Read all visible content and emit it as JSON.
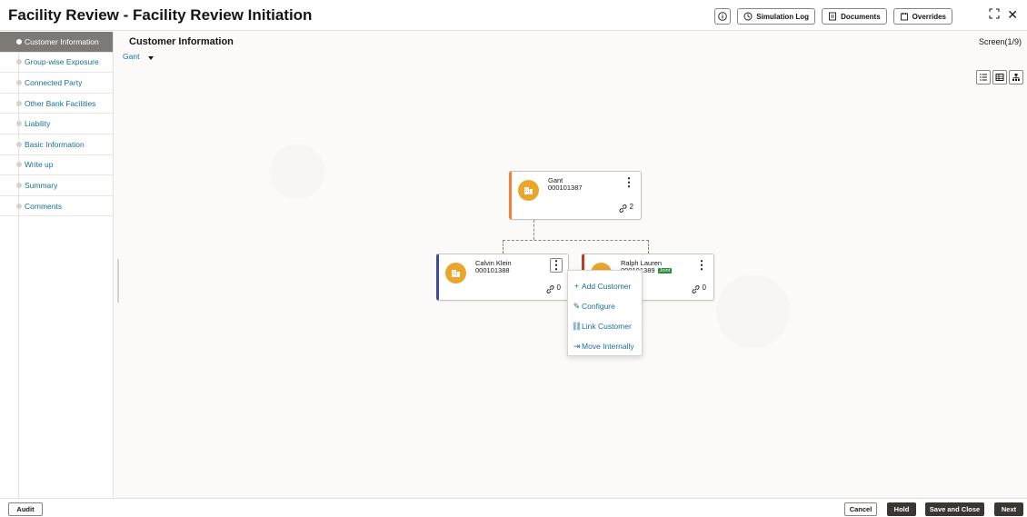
{
  "header": {
    "title": "Facility Review - Facility Review Initiation",
    "buttons": {
      "info_icon": "info-icon",
      "simulation_log": "Simulation Log",
      "documents": "Documents",
      "overrides": "Overrides"
    },
    "controls": {
      "expand": "⛶",
      "close": "✕"
    }
  },
  "sidebar": {
    "items": [
      {
        "label": "Customer Information",
        "active": true
      },
      {
        "label": "Group-wise Exposure"
      },
      {
        "label": "Connected Party"
      },
      {
        "label": "Other Bank Facilities"
      },
      {
        "label": "Liability"
      },
      {
        "label": "Basic Information"
      },
      {
        "label": "Write up"
      },
      {
        "label": "Summary"
      },
      {
        "label": "Comments"
      }
    ]
  },
  "main": {
    "title": "Customer Information",
    "screen_counter": "Screen(1/9)",
    "party_selector": "Gant",
    "view_toggle": [
      "list-view-icon",
      "table-view-icon",
      "tree-view-icon"
    ]
  },
  "tree": {
    "root": {
      "name": "Gant",
      "id": "000101387",
      "link_count": "2"
    },
    "children": [
      {
        "name": "Calvin Klein",
        "id": "000101388",
        "link_count": "0"
      },
      {
        "name": "Ralph Lauren",
        "id": "000101389",
        "badge": "Joint",
        "link_count": "0"
      }
    ]
  },
  "context_menu": {
    "items": [
      {
        "icon": "+",
        "label": "Add Customer"
      },
      {
        "icon": "✎",
        "label": "Configure"
      },
      {
        "icon": "⛓",
        "label": "Link Customer"
      },
      {
        "icon": "⇥",
        "label": "Move Internally"
      }
    ]
  },
  "footer": {
    "audit": "Audit",
    "cancel": "Cancel",
    "hold": "Hold",
    "save_close": "Save and Close",
    "next": "Next"
  },
  "colors": {
    "accent_link": "#1a6e99",
    "root_card_accent": "#f0803c",
    "child1_accent": "#3e4a9e",
    "child2_accent": "#c0392b",
    "avatar": "#e9a62a",
    "joint_badge": "#2a8a3c"
  }
}
